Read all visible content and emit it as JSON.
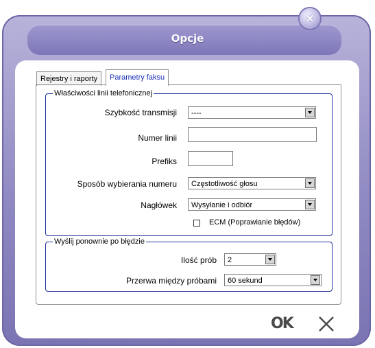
{
  "window": {
    "title": "Opcje"
  },
  "tabs": [
    {
      "label": "Rejestry i raporty",
      "active": false
    },
    {
      "label": "Parametry faksu",
      "active": true
    }
  ],
  "line_properties": {
    "legend": "Właściwości linii telefonicznej",
    "speed_label": "Szybkość transmisji",
    "speed_value": "----",
    "line_number_label": "Numer linii",
    "line_number_value": "",
    "prefix_label": "Prefiks",
    "prefix_value": "",
    "dialing_label": "Sposób wybierania numeru",
    "dialing_value": "Częstotliwość głosu",
    "header_label": "Nagłówek",
    "header_value": "Wysyłanie i odbiór",
    "ecm_label": "ECM (Poprawianie błędów)",
    "ecm_checked": false
  },
  "resend": {
    "legend": "Wyślij ponownie po błędzie",
    "attempts_label": "Ilość prób",
    "attempts_value": "2",
    "interval_label": "Przerwa między próbami",
    "interval_value": "60 sekund"
  },
  "buttons": {
    "ok_label": "OK",
    "close_glyph": "✕"
  },
  "colors": {
    "frame": "#8f8ac2",
    "group_border": "#1f2f9a",
    "active_tab_text": "#1a2fb6"
  }
}
